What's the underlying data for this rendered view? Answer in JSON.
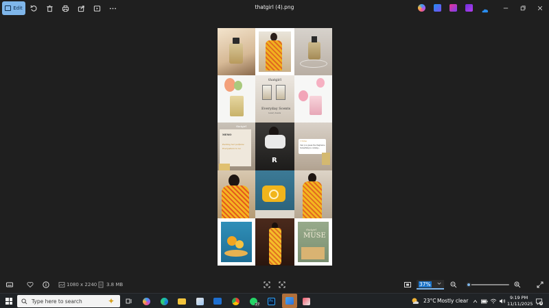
{
  "toolbar": {
    "edit_label": "Edit",
    "icons": [
      "rotate-icon",
      "delete-icon",
      "print-icon",
      "share-icon",
      "slideshow-icon",
      "more-icon"
    ]
  },
  "window": {
    "title": "thatgirl (4).png"
  },
  "image": {
    "tiles": {
      "t5_top": "thatgirl",
      "t5_mid": "Everyday Scents",
      "t5_bot": "Luxury Scents",
      "t7_head": "MEMO",
      "t7_line1": "Packing her perfume",
      "t7_line2": "Everywhere to be",
      "t7_brand": "thatgirl",
      "t9_head": "1 Notes",
      "t9_line1": "Can you guess the fragrance",
      "t9_line2": "Something is coming...",
      "t15_small": "thatgirl",
      "t15_big": "MUSE"
    }
  },
  "statusbar": {
    "dimensions": "1080 x 2240",
    "filesize": "3.8 MB",
    "zoom": "37%",
    "zoom_level": 0.37
  },
  "taskbar": {
    "search_placeholder": "Type here to search",
    "whatsapp_badge": "27",
    "weather_temp": "23°C",
    "weather_desc": "Mostly clear",
    "time": "9:19 PM",
    "date": "11/11/2025",
    "notif_count": "9"
  },
  "colors": {
    "accent": "#7fb6ea",
    "background": "#1f1f1f",
    "taskbar": "#202326"
  }
}
